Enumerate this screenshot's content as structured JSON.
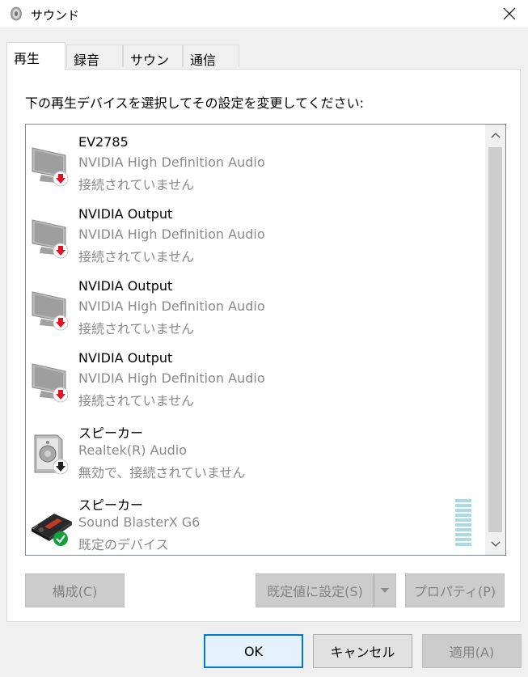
{
  "window": {
    "title": "サウンド"
  },
  "tabs": [
    {
      "label": "再生",
      "active": true
    },
    {
      "label": "録音",
      "active": false
    },
    {
      "label": "サウンド",
      "active": false
    },
    {
      "label": "通信",
      "active": false
    }
  ],
  "instruction": "下の再生デバイスを選択してその設定を変更してください:",
  "devices": [
    {
      "name": "EV2785",
      "driver": "NVIDIA High Definition Audio",
      "status": "接続されていません",
      "icon": "monitor-icon",
      "badge": "disconnected-badge-icon"
    },
    {
      "name": "NVIDIA Output",
      "driver": "NVIDIA High Definition Audio",
      "status": "接続されていません",
      "icon": "monitor-icon",
      "badge": "disconnected-badge-icon"
    },
    {
      "name": "NVIDIA Output",
      "driver": "NVIDIA High Definition Audio",
      "status": "接続されていません",
      "icon": "monitor-icon",
      "badge": "disconnected-badge-icon"
    },
    {
      "name": "NVIDIA Output",
      "driver": "NVIDIA High Definition Audio",
      "status": "接続されていません",
      "icon": "monitor-icon",
      "badge": "disconnected-badge-icon"
    },
    {
      "name": "スピーカー",
      "driver": "Realtek(R) Audio",
      "status": "無効で、接続されていません",
      "icon": "speaker-icon",
      "badge": "disabled-badge-icon"
    },
    {
      "name": "スピーカー",
      "driver": "Sound BlasterX G6",
      "status": "既定のデバイス",
      "icon": "sound-blaster-icon",
      "badge": "default-check-icon"
    }
  ],
  "buttons": {
    "configure": "構成(C)",
    "set_default": "既定値に設定(S)",
    "properties": "プロパティ(P)",
    "ok": "OK",
    "cancel": "キャンセル",
    "apply": "適用(A)"
  },
  "colors": {
    "accent": "#0078d7",
    "disconnected": "#e81123",
    "default_check": "#10a33c",
    "vu_meter": "#a8dbe4"
  }
}
